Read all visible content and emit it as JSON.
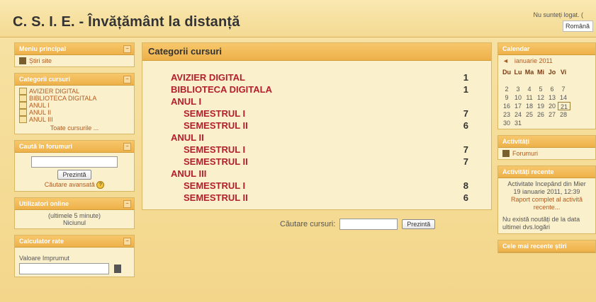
{
  "header": {
    "title": "C. S. I. E. - Învățământ la distanță",
    "login_text": "Nu sunteți logat. (",
    "language": "Română"
  },
  "left": {
    "main_menu": {
      "title": "Meniu principal",
      "site_news": "Știri site"
    },
    "categories": {
      "title": "Categorii cursuri",
      "items": [
        "AVIZIER DIGITAL",
        "BIBLIOTECA DIGITALA",
        "ANUL I",
        "ANUL II",
        "ANUL III"
      ],
      "all_courses": "Toate cursurile ..."
    },
    "forum_search": {
      "title": "Caută în forumuri",
      "button": "Prezintă",
      "advanced": "Căutare avansată"
    },
    "online_users": {
      "title": "Utilizatori online",
      "range": "(ultimele 5 minute)",
      "none": "Niciunul"
    },
    "calculator": {
      "title": "Calculator rate",
      "label": "Valoare Imprumut"
    }
  },
  "main": {
    "title": "Categorii cursuri",
    "rows": [
      {
        "name": "AVIZIER DIGITAL",
        "count": "1",
        "sub": false
      },
      {
        "name": "BIBLIOTECA DIGITALA",
        "count": "1",
        "sub": false
      },
      {
        "name": "ANUL I",
        "count": "",
        "sub": false
      },
      {
        "name": "SEMESTRUL I",
        "count": "7",
        "sub": true
      },
      {
        "name": "SEMESTRUL II",
        "count": "6",
        "sub": true
      },
      {
        "name": "ANUL II",
        "count": "",
        "sub": false
      },
      {
        "name": "SEMESTRUL I",
        "count": "7",
        "sub": true
      },
      {
        "name": "SEMESTRUL II",
        "count": "7",
        "sub": true
      },
      {
        "name": "ANUL III",
        "count": "",
        "sub": false
      },
      {
        "name": "SEMESTRUL I",
        "count": "8",
        "sub": true
      },
      {
        "name": "SEMESTRUL II",
        "count": "6",
        "sub": true
      }
    ],
    "search_label": "Căutare cursuri:",
    "search_button": "Prezintă"
  },
  "right": {
    "calendar": {
      "title": "Calendar",
      "month": "ianuarie 2011",
      "days": [
        "Du",
        "Lu",
        "Ma",
        "Mi",
        "Jo",
        "Vi"
      ],
      "weeks": [
        [
          "",
          "",
          "",
          "",
          "",
          ""
        ],
        [
          "2",
          "3",
          "4",
          "5",
          "6",
          "7"
        ],
        [
          "9",
          "10",
          "11",
          "12",
          "13",
          "14"
        ],
        [
          "16",
          "17",
          "18",
          "19",
          "20",
          "21"
        ],
        [
          "23",
          "24",
          "25",
          "26",
          "27",
          "28"
        ],
        [
          "30",
          "31",
          "",
          "",
          "",
          ""
        ]
      ],
      "today": "21"
    },
    "activities": {
      "title": "Activități",
      "forums": "Forumuri"
    },
    "recent_activity": {
      "title": "Activități recente",
      "line1": "Activitate începând din Mier",
      "line2": "19 ianuarie 2011, 12:39",
      "line3": "Raport complet al activită",
      "line4": "recente...",
      "note": "Nu există noutăți de la data ultimei dvs.logări"
    },
    "latest_news": {
      "title": "Cele mai recente știri"
    }
  }
}
